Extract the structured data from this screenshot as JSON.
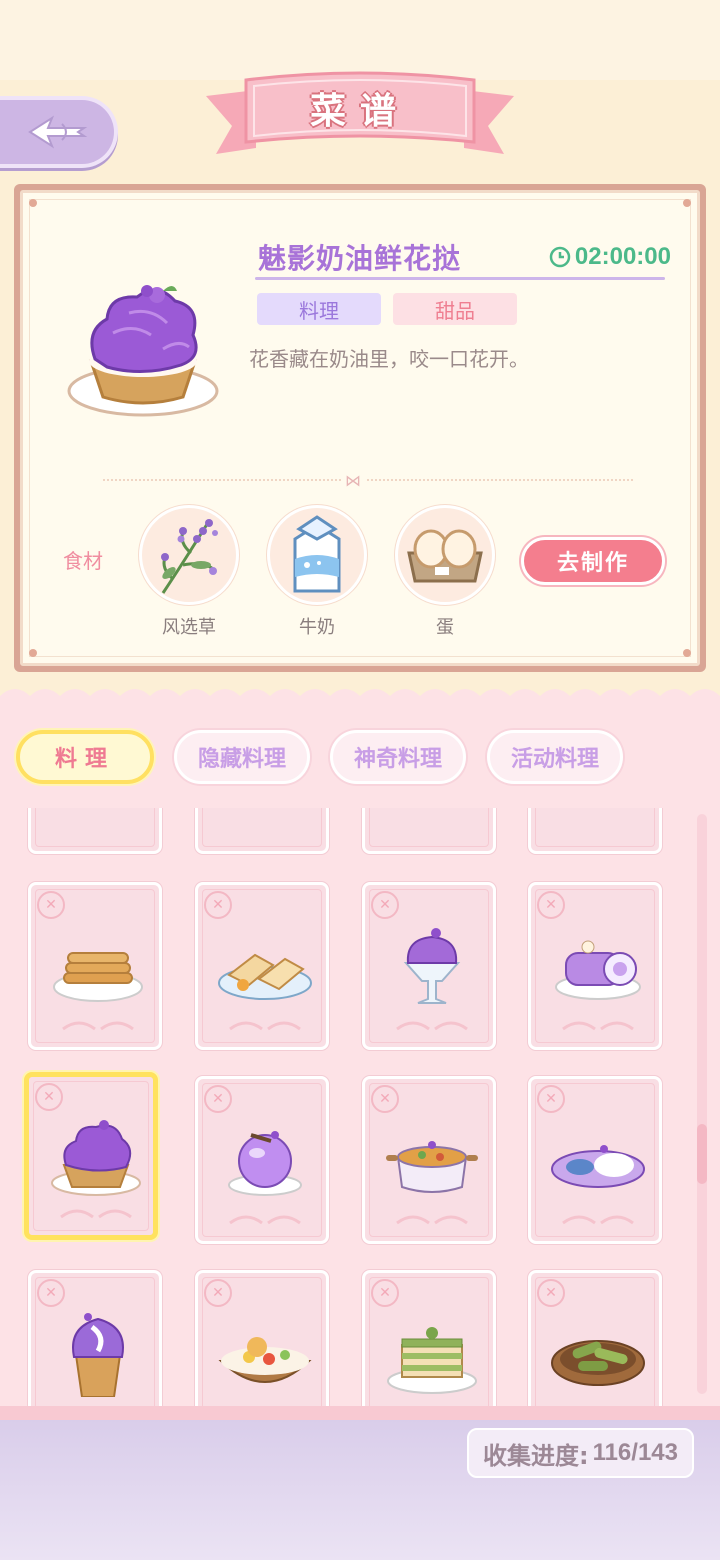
{
  "header": {
    "title": "菜谱",
    "back_icon": "back-arrow-icon"
  },
  "recipe_detail": {
    "name": "魅影奶油鲜花挞",
    "timer": "02:00:00",
    "tags": [
      "料理",
      "甜品"
    ],
    "description": "花香藏在奶油里，咬一口花开。",
    "ingredients_label": "食材",
    "ingredients": [
      {
        "name": "风选草",
        "icon": "lavender-herb-icon"
      },
      {
        "name": "牛奶",
        "icon": "milk-carton-icon"
      },
      {
        "name": "蛋",
        "icon": "egg-tray-icon"
      }
    ],
    "make_button": "去制作"
  },
  "tabs": [
    {
      "label": "料理",
      "active": true
    },
    {
      "label": "隐藏料理",
      "active": false
    },
    {
      "label": "神奇料理",
      "active": false
    },
    {
      "label": "活动料理",
      "active": false
    }
  ],
  "recipes": [
    {
      "icon": "pancake-stack-icon"
    },
    {
      "icon": "toast-sandwich-icon"
    },
    {
      "icon": "purple-sundae-icon"
    },
    {
      "icon": "purple-roll-cake-icon"
    },
    {
      "icon": "purple-cream-tart-icon",
      "selected": true
    },
    {
      "icon": "purple-mousse-icon"
    },
    {
      "icon": "stew-pot-icon"
    },
    {
      "icon": "purple-rice-dish-icon"
    },
    {
      "icon": "purple-ice-cream-cup-icon"
    },
    {
      "icon": "salad-bowl-icon"
    },
    {
      "icon": "matcha-cake-icon"
    },
    {
      "icon": "green-bean-dish-icon"
    }
  ],
  "collection": {
    "label": "收集进度:",
    "value": "116/143"
  },
  "colors": {
    "accent_purple": "#a873d8",
    "accent_pink": "#f47e8e",
    "timer_green": "#4cb98a",
    "selected_border": "#ffe25e"
  }
}
